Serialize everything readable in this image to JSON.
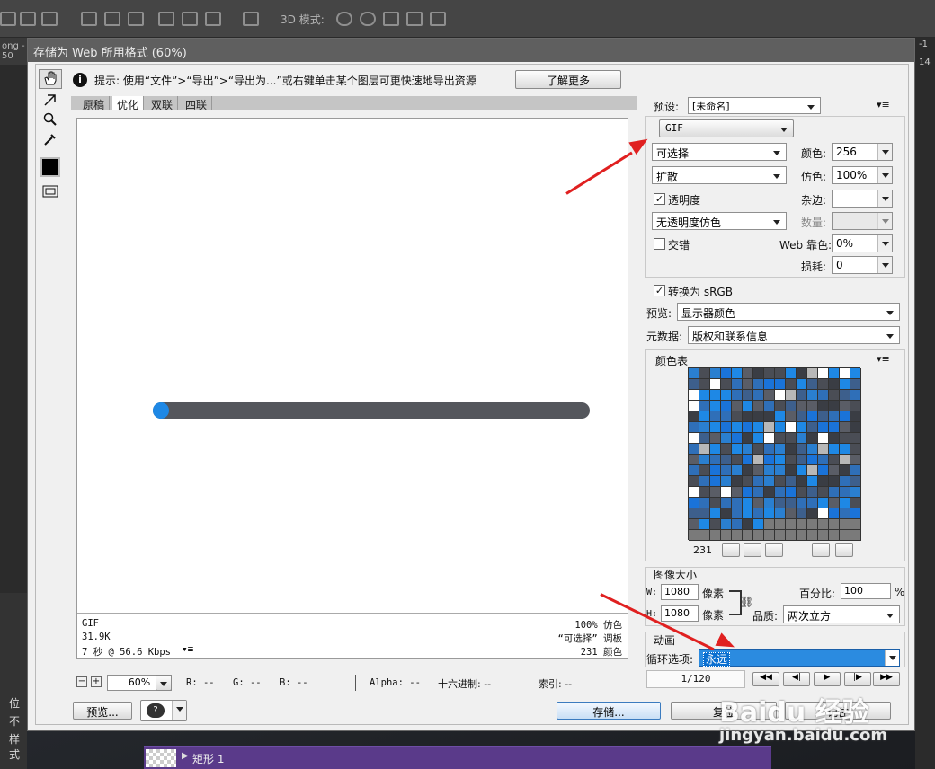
{
  "ps": {
    "mode3d": "3D 模式:",
    "left_tab": "ong -",
    "left_ruler": "50",
    "right_ruler": "14",
    "right_top": "-1",
    "layers": [
      "位",
      "不",
      "样式"
    ],
    "layer_name": "矩形 1"
  },
  "dialog": {
    "title": "存储为 Web 所用格式 (60%)",
    "hint_text": "提示: 使用“文件”>“导出”>“导出为...”或右键单击某个图层可更快速地导出资源",
    "learn_more": "了解更多",
    "tabs": [
      "原稿",
      "优化",
      "双联",
      "四联"
    ],
    "active_tab": 1,
    "preview_info": {
      "format": "GIF",
      "size": "31.9K",
      "time": "7 秒 @ 56.6 Kbps",
      "dither": "100% 仿色",
      "palette": "“可选择” 调板",
      "colors": "231 颜色"
    },
    "progress_fraction": 0.035,
    "status": {
      "zoom": "60%",
      "r": "R: --",
      "g": "G: --",
      "b": "B: --",
      "alpha": "Alpha: --",
      "hex": "十六进制: --",
      "index": "索引: --"
    },
    "buttons": {
      "preview": "预览...",
      "save": "存储...",
      "cancel": "复位",
      "done": "记住"
    },
    "settings": {
      "preset_label": "预设:",
      "preset_value": "[未命名]",
      "format": "GIF",
      "reduction": "可选择",
      "colors_label": "颜色:",
      "colors_value": "256",
      "dither_algo": "扩散",
      "dither_label": "仿色:",
      "dither_value": "100%",
      "transparency": "透明度",
      "matte_label": "杂边:",
      "matte_value": "",
      "trans_dither": "无透明度仿色",
      "amount_label": "数量:",
      "interlaced": "交错",
      "websnap_label": "Web 靠色:",
      "websnap_value": "0%",
      "lossy_label": "损耗:",
      "lossy_value": "0",
      "convert_srgb": "转换为 sRGB",
      "preview_label": "预览:",
      "preview_value": "显示器颜色",
      "metadata_label": "元数据:",
      "metadata_value": "版权和联系信息"
    },
    "color_table": {
      "title": "颜色表",
      "count": "231"
    },
    "image_size": {
      "title": "图像大小",
      "w_label": "W:",
      "w_value": "1080",
      "h_label": "H:",
      "h_value": "1080",
      "unit": "像素",
      "percent_label": "百分比:",
      "percent_value": "100",
      "percent_unit": "%",
      "quality_label": "品质:",
      "quality_value": "两次立方"
    },
    "animation": {
      "title": "动画",
      "loop_label": "循环选项:",
      "loop_value": "永远",
      "frame": "1/120"
    }
  },
  "watermark": {
    "brand": "Baidu 经验",
    "url": "jingyan.baidu.com"
  },
  "colors": {
    "accent_blue": "#1e88e5",
    "bar_gray": "#54565c",
    "annotation_red": "#e02020"
  }
}
